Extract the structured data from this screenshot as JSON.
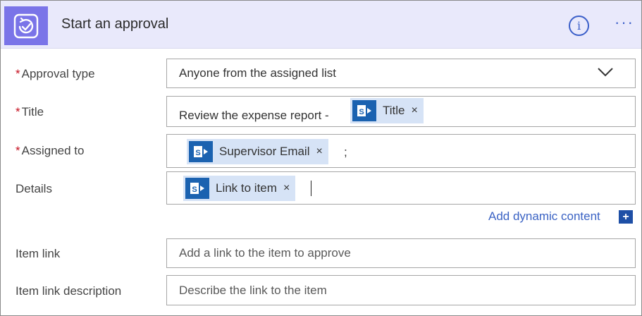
{
  "header": {
    "title": "Start an approval",
    "app_icon": "approvals-icon",
    "info_icon_glyph": "i",
    "more_icon_glyph": "···",
    "background": "#e9e9fb",
    "tile_color": "#7a74e8"
  },
  "required_marker": "*",
  "fields": {
    "approval_type": {
      "label": "Approval type",
      "value": "Anyone from the assigned list"
    },
    "title": {
      "label": "Title",
      "prefix_text": "Review the expense report -",
      "token_label": "Title"
    },
    "assigned_to": {
      "label": "Assigned to",
      "token_label": "Supervisor Email",
      "separator": ";"
    },
    "details": {
      "label": "Details",
      "token_label": "Link to item"
    },
    "item_link": {
      "label": "Item link",
      "placeholder": "Add a link to the item to approve"
    },
    "item_link_description": {
      "label": "Item link description",
      "placeholder": "Describe the link to the item"
    }
  },
  "token_remove_glyph": "×",
  "add_dynamic_content": {
    "label": "Add dynamic content",
    "icon_glyph": "+"
  },
  "colors": {
    "accent": "#3b63c4",
    "required": "#c50f1f",
    "token_bg": "#d6e3f6",
    "sharepoint_blue": "#1b62b0"
  }
}
